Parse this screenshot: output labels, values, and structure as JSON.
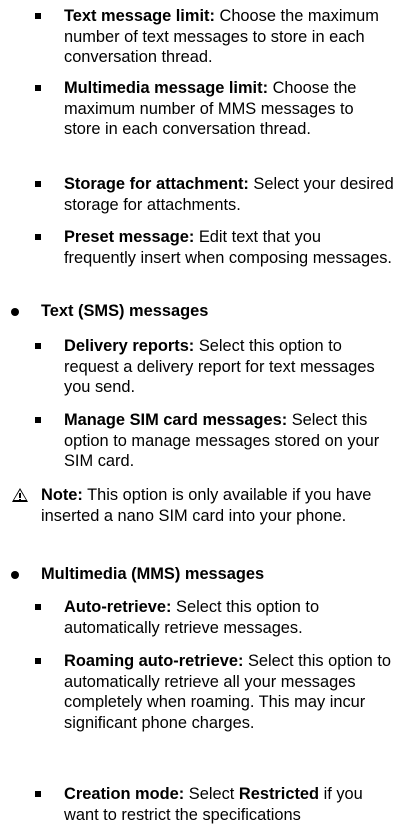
{
  "items": [
    {
      "type": "sub",
      "bold": "Text message limit:",
      "text": " Choose the maximum number of text messages to store in each conversation thread."
    },
    {
      "type": "sub",
      "bold": "Multimedia message limit:",
      "text": " Choose the maximum number of MMS messages to store in each conversation thread."
    },
    {
      "type": "sub",
      "bold": "Storage for attachment:",
      "text": " Select your desired storage for attachments."
    },
    {
      "type": "sub",
      "bold": "Preset message:",
      "text": " Edit text that you frequently insert when composing messages."
    },
    {
      "type": "main",
      "bold": "Text (SMS) messages"
    },
    {
      "type": "sub",
      "bold": "Delivery reports:",
      "text": " Select this option to request a delivery report for text messages you send."
    },
    {
      "type": "sub",
      "bold": "Manage SIM card messages:",
      "text": " Select this option to manage messages stored on your SIM card."
    },
    {
      "type": "note",
      "bold": "Note:",
      "text": " This option is only available if you have inserted a nano SIM card into your phone."
    },
    {
      "type": "main",
      "bold": "Multimedia (MMS) messages"
    },
    {
      "type": "sub",
      "bold": "Auto-retrieve:",
      "text": " Select this option to automatically retrieve messages."
    },
    {
      "type": "sub",
      "bold": "Roaming auto-retrieve:",
      "text": " Select this option to automatically retrieve all your messages completely when roaming. This may incur significant phone charges."
    },
    {
      "type": "sub",
      "bold": "Creation mode:",
      "text": " Select ",
      "bold2": "Restricted",
      "text2": " if you want to restrict the specifications"
    }
  ]
}
